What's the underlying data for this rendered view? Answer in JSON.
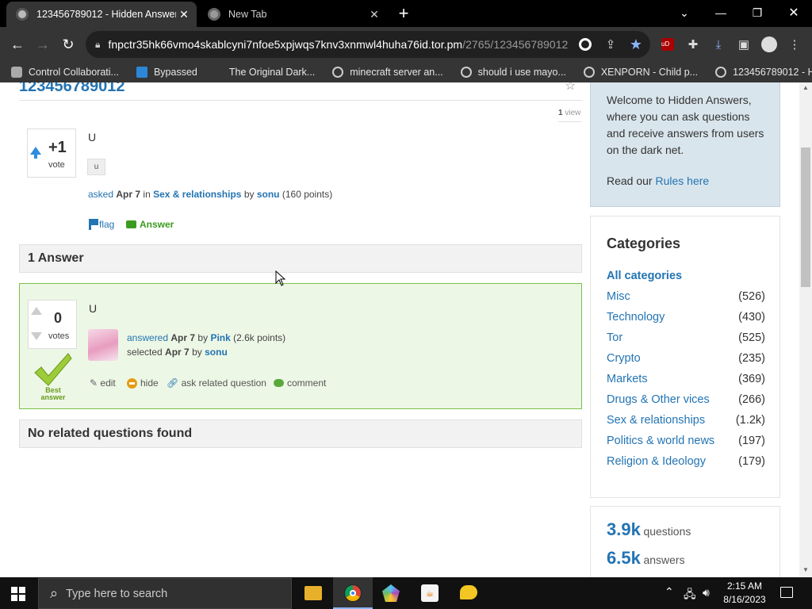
{
  "browser": {
    "tabs": [
      {
        "title": "123456789012 - Hidden Answers",
        "active": true
      },
      {
        "title": "New Tab",
        "active": false
      }
    ],
    "url_main": "fnpctr35hk66vmo4skablcyni7nfoe5xpjwqs7knv3xnmwl4huha76id.tor.pm",
    "url_path": "/2765/123456789012",
    "bookmarks": [
      "Control Collaborati...",
      "Bypassed",
      "The Original Dark...",
      "minecraft server an...",
      "should i use mayo...",
      "XENPORN - Child p...",
      "123456789012 - Hi..."
    ]
  },
  "question": {
    "title": "123456789012",
    "views_count": "1",
    "views_label": "view",
    "votes": "+1",
    "votes_label": "vote",
    "body": "U",
    "tag": "u",
    "meta": {
      "asked": "asked",
      "date": "Apr 7",
      "in": "in",
      "category": "Sex & relationships",
      "by": "by",
      "user": "sonu",
      "points": "(160 points)"
    },
    "actions": {
      "flag": "flag",
      "answer": "Answer"
    }
  },
  "answers_header": "1 Answer",
  "answer": {
    "votes": "0",
    "votes_label": "votes",
    "best_label_1": "Best",
    "best_label_2": "answer",
    "body": "U",
    "answered": "answered",
    "date": "Apr 7",
    "by": "by",
    "user": "Pink",
    "points": "(2.6k points)",
    "selected": "selected",
    "sel_date": "Apr 7",
    "sel_by": "by",
    "sel_user": "sonu",
    "actions": {
      "edit": "edit",
      "hide": "hide",
      "related": "ask related question",
      "comment": "comment"
    }
  },
  "related_header": "No related questions found",
  "sidebar": {
    "welcome": "Welcome to Hidden Answers, where you can ask questions and receive answers from users on the dark net.",
    "rules_prefix": "Read our",
    "rules_link": "Rules here",
    "categories_title": "Categories",
    "all_categories": "All categories",
    "categories": [
      {
        "name": "Misc",
        "count": "(526)"
      },
      {
        "name": "Technology",
        "count": "(430)"
      },
      {
        "name": "Tor",
        "count": "(525)"
      },
      {
        "name": "Crypto",
        "count": "(235)"
      },
      {
        "name": "Markets",
        "count": "(369)"
      },
      {
        "name": "Drugs & Other vices",
        "count": "(266)"
      },
      {
        "name": "Sex & relationships",
        "count": "(1.2k)"
      },
      {
        "name": "Politics & world news",
        "count": "(197)"
      },
      {
        "name": "Religion & Ideology",
        "count": "(179)"
      }
    ],
    "stats": [
      {
        "value": "3.9k",
        "label": "questions"
      },
      {
        "value": "6.5k",
        "label": "answers"
      }
    ]
  },
  "taskbar": {
    "search_placeholder": "Type here to search",
    "time": "2:15 AM",
    "date": "8/16/2023"
  },
  "colors": {
    "link": "#2374b3",
    "answer_bg": "#edf7e6",
    "answer_border": "#7bc048",
    "welcome_bg": "#d9e5ec"
  }
}
